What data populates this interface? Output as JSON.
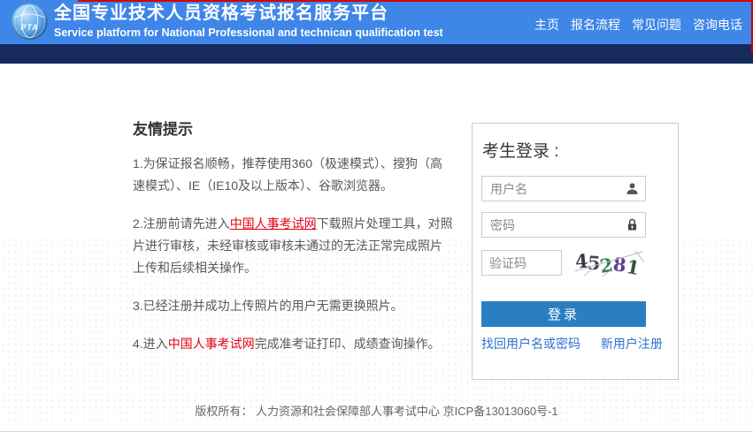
{
  "header": {
    "logo_text": "PTA",
    "title": "全国专业技术人员资格考试报名服务平台",
    "subtitle": "Service platform for National Professional and technican qualification test",
    "nav": [
      {
        "label": "主页"
      },
      {
        "label": "报名流程"
      },
      {
        "label": "常见问题"
      },
      {
        "label": "咨询电话"
      }
    ]
  },
  "tips": {
    "heading": "友情提示",
    "p1": "1.为保证报名顺畅，推荐使用360（极速模式）、搜狗（高速模式）、IE（IE10及以上版本）、谷歌浏览器。",
    "p2_prefix": "2.注册前请先进入",
    "cpta_link": "中国人事考试网",
    "p2_suffix": "下载照片处理工具，对照片进行审核，未经审核或审核未通过的无法正常完成照片上传和后续相关操作。",
    "p3": "3.已经注册并成功上传照片的用户无需更换照片。",
    "p4_prefix": "4.进入",
    "p4_suffix": "完成准考证打印、成绩查询操作。"
  },
  "login": {
    "title": "考生登录 :",
    "username_placeholder": "用户名",
    "password_placeholder": "密码",
    "captcha_placeholder": "验证码",
    "captcha_value": "45281",
    "captcha_digits": [
      "4",
      "5",
      "2",
      "8",
      "1"
    ],
    "login_button": "登录",
    "forgot_link": "找回用户名或密码",
    "register_link": "新用户注册"
  },
  "footer": {
    "text": "版权所有： 人力资源和社会保障部人事考试中心 京ICP备13013060号-1"
  },
  "colors": {
    "header_blue": "#3e86e8",
    "navy_band": "#162a5e",
    "annotation_red": "#d40000",
    "button_blue": "#2a7fc3",
    "link_blue": "#2e6fd0",
    "link_red": "#e60012"
  }
}
